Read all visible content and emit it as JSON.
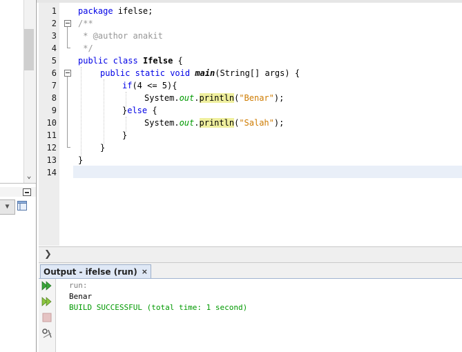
{
  "editor": {
    "line_numbers": [
      "1",
      "2",
      "3",
      "4",
      "5",
      "6",
      "7",
      "8",
      "9",
      "10",
      "11",
      "12",
      "13",
      "14"
    ],
    "lines": {
      "l1": {
        "kw": "package",
        "rest": " ifelse;"
      },
      "l2": {
        "comment": "/**"
      },
      "l3": {
        "comment": " * @author anakit"
      },
      "l4": {
        "comment": " */"
      },
      "l5": {
        "kw1": "public",
        "kw2": "class",
        "name": "Ifelse",
        "rest": " {"
      },
      "l6": {
        "kw1": "public",
        "kw2": "static",
        "kw3": "void",
        "method": "main",
        "rest": "(String[] args) {"
      },
      "l7": {
        "kw": "if",
        "rest": "(4 <= 5){"
      },
      "l8": {
        "obj": "System.",
        "field": "out",
        "dot": ".",
        "method": "println",
        "args_open": "(",
        "string": "\"Benar\"",
        "args_close": ");"
      },
      "l9": {
        "pre": "}",
        "kw": "else",
        "rest": " {"
      },
      "l10": {
        "obj": "System.",
        "field": "out",
        "dot": ".",
        "method": "println",
        "args_open": "(",
        "string": "\"Salah\"",
        "args_close": ");"
      },
      "l11": {
        "text": "}"
      },
      "l12": {
        "text": "}"
      },
      "l13": {
        "text": "}"
      }
    }
  },
  "output": {
    "tab_label": "Output - ifelse (run)",
    "close_label": "×",
    "lines": [
      "run:",
      "Benar",
      "BUILD SUCCESSFUL (total time: 1 second)"
    ]
  },
  "icons": {
    "rerun": "rerun-icon",
    "rerun_with_options": "rerun-options-icon",
    "stop": "stop-icon",
    "settings": "settings-icon"
  },
  "colors": {
    "keyword": "#0000e6",
    "comment": "#969696",
    "string": "#ce7b00",
    "field": "#009900",
    "success": "#009900",
    "highlight": "#efef9e"
  }
}
